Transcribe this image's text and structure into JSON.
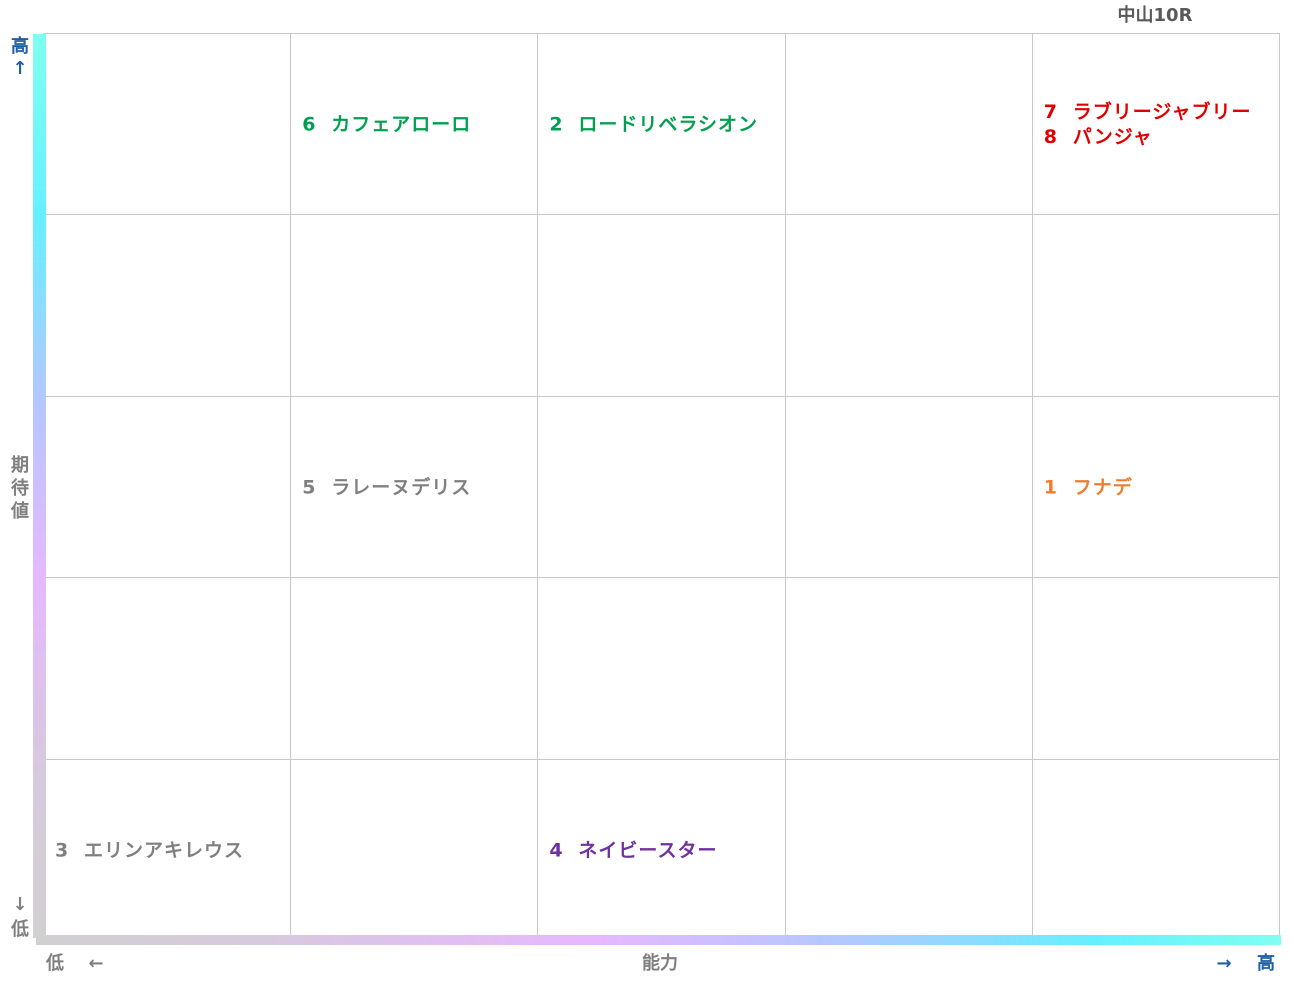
{
  "chart_data": {
    "type": "table",
    "title": "中山10R",
    "xlabel": "能力",
    "ylabel": "期待値",
    "x_low": "低",
    "x_low_arrow": "←",
    "x_high": "高",
    "x_high_arrow": "→",
    "y_high": "高",
    "y_high_arrow": "↑",
    "y_low": "低",
    "y_low_arrow": "↓",
    "columns": 5,
    "rows": 5,
    "grid": true,
    "colors": {
      "green": "#00a050",
      "red": "#e00000",
      "orange": "#ed7d31",
      "gray": "#7f7f7f",
      "purple": "#7030a0",
      "grid": "#c8c8c8"
    },
    "cells": [
      {
        "col": 1,
        "row": 0,
        "entries": [
          {
            "number": "6",
            "name": "カフェアローロ",
            "color": "#00a050"
          }
        ]
      },
      {
        "col": 2,
        "row": 0,
        "entries": [
          {
            "number": "2",
            "name": "ロードリベラシオン",
            "color": "#00a050"
          }
        ]
      },
      {
        "col": 4,
        "row": 0,
        "entries": [
          {
            "number": "7",
            "name": "ラブリージャブリー",
            "color": "#e00000"
          },
          {
            "number": "8",
            "name": "パンジャ",
            "color": "#e00000"
          }
        ]
      },
      {
        "col": 1,
        "row": 2,
        "entries": [
          {
            "number": "5",
            "name": "ラレーヌデリス",
            "color": "#7f7f7f"
          }
        ]
      },
      {
        "col": 4,
        "row": 2,
        "entries": [
          {
            "number": "1",
            "name": "フナデ",
            "color": "#ed7d31"
          }
        ]
      },
      {
        "col": 0,
        "row": 4,
        "entries": [
          {
            "number": "3",
            "name": "エリンアキレウス",
            "color": "#7f7f7f"
          }
        ]
      },
      {
        "col": 2,
        "row": 4,
        "entries": [
          {
            "number": "4",
            "name": "ネイビースター",
            "color": "#7030a0"
          }
        ]
      }
    ]
  }
}
